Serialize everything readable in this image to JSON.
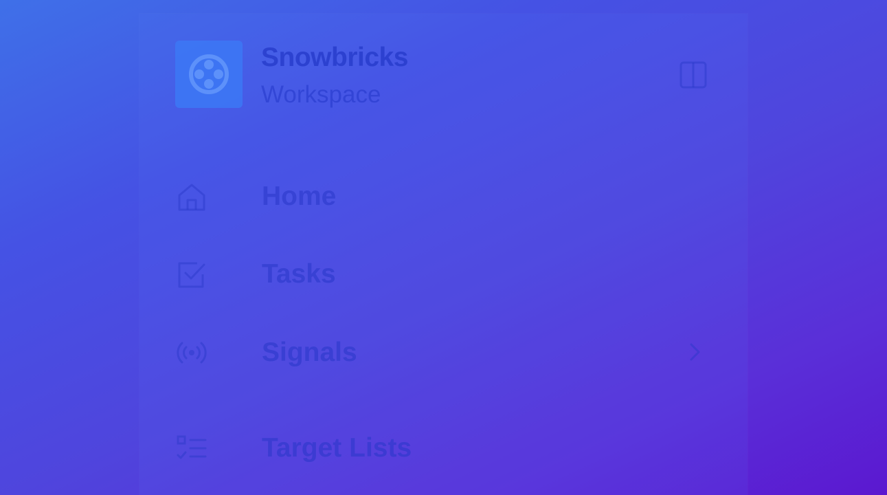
{
  "workspace": {
    "name": "Snowbricks",
    "subtitle": "Workspace",
    "logo_icon": "snowflake-brick-logo"
  },
  "header": {
    "toggle_icon": "sidebar-toggle-icon"
  },
  "nav": {
    "items": [
      {
        "label": "Home",
        "icon": "home-icon"
      },
      {
        "label": "Tasks",
        "icon": "checkbox-icon"
      },
      {
        "label": "Signals",
        "icon": "signal-broadcast-icon",
        "has_submenu": true
      },
      {
        "label": "Target Lists",
        "icon": "checklist-icon"
      }
    ]
  },
  "colors": {
    "gradient_start": "#3f70e8",
    "gradient_end": "#5b18d0",
    "muted_text": "#2c3ac4",
    "logo_tile": "#3c78f5"
  }
}
